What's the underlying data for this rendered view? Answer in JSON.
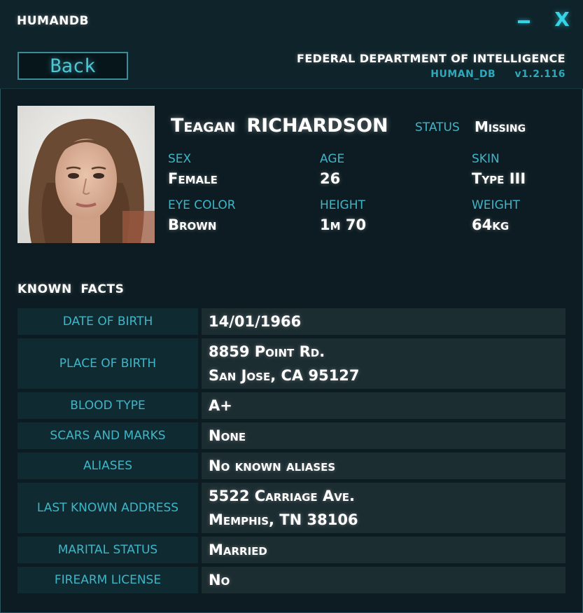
{
  "window": {
    "title": "HUMANDB",
    "minimize_glyph": "–",
    "close_glyph": "X"
  },
  "header": {
    "back_label": "Back",
    "agency": "FEDERAL DEPARTMENT OF INTELLIGENCE",
    "db_name": "HUMAN_DB",
    "version": "v1.2.116"
  },
  "profile": {
    "first_name": "Teagan",
    "last_name": "RICHARDSON",
    "status_label": "STATUS",
    "status_value": "Missing",
    "attributes": [
      {
        "label": "SEX",
        "value": "Female"
      },
      {
        "label": "AGE",
        "value": "26"
      },
      {
        "label": "SKIN",
        "value": "Type III"
      },
      {
        "label": "EYE COLOR",
        "value": "Brown"
      },
      {
        "label": "HEIGHT",
        "value": "1m 70"
      },
      {
        "label": "WEIGHT",
        "value": "64kg"
      }
    ]
  },
  "facts": {
    "title": "KNOWN  FACTS",
    "rows": [
      {
        "label": "DATE OF BIRTH",
        "line1": "14/01/1966",
        "line2": ""
      },
      {
        "label": "PLACE OF BIRTH",
        "line1": "8859 Point Rd.",
        "line2": "San Jose, CA 95127"
      },
      {
        "label": "BLOOD TYPE",
        "line1": "A+",
        "line2": ""
      },
      {
        "label": "SCARS AND MARKS",
        "line1": "None",
        "line2": ""
      },
      {
        "label": "ALIASES",
        "line1": "No known aliases",
        "line2": ""
      },
      {
        "label": "LAST KNOWN ADDRESS",
        "line1": "5522 Carriage Ave.",
        "line2": "Memphis, TN 38106"
      },
      {
        "label": "MARITAL STATUS",
        "line1": "Married",
        "line2": ""
      },
      {
        "label": "FIREARM LICENSE",
        "line1": "No",
        "line2": ""
      }
    ]
  },
  "colors": {
    "accent": "#3fb6c8",
    "window_button": "#35d4e6",
    "background": "#0c1c22"
  }
}
